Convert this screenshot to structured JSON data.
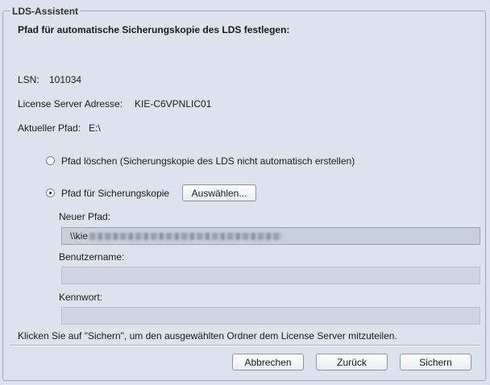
{
  "dialog": {
    "title": "LDS-Assistent",
    "heading": "Pfad für automatische Sicherungskopie des LDS festlegen:"
  },
  "info": {
    "lsn_label": "LSN:",
    "lsn_value": "101034",
    "server_label": "License Server Adresse:",
    "server_value": "KIE-C6VPNLIC01",
    "current_path_label": "Aktueller Pfad:",
    "current_path_value": "E:\\"
  },
  "options": {
    "delete_path": {
      "label": "Pfad löschen (Sicherungskopie des LDS nicht automatisch erstellen)",
      "selected": false
    },
    "backup_path": {
      "label": "Pfad für Sicherungskopie",
      "selected": true,
      "browse_label": "Auswählen..."
    }
  },
  "form": {
    "new_path_label": "Neuer Pfad:",
    "new_path_value": "\\\\kie",
    "username_label": "Benutzername:",
    "username_value": "",
    "password_label": "Kennwort:",
    "password_value": ""
  },
  "hint": "Klicken Sie auf \"Sichern\", um den ausgewählten Ordner dem License Server mitzuteilen.",
  "buttons": {
    "cancel": "Abbrechen",
    "back": "Zurück",
    "save": "Sichern"
  }
}
